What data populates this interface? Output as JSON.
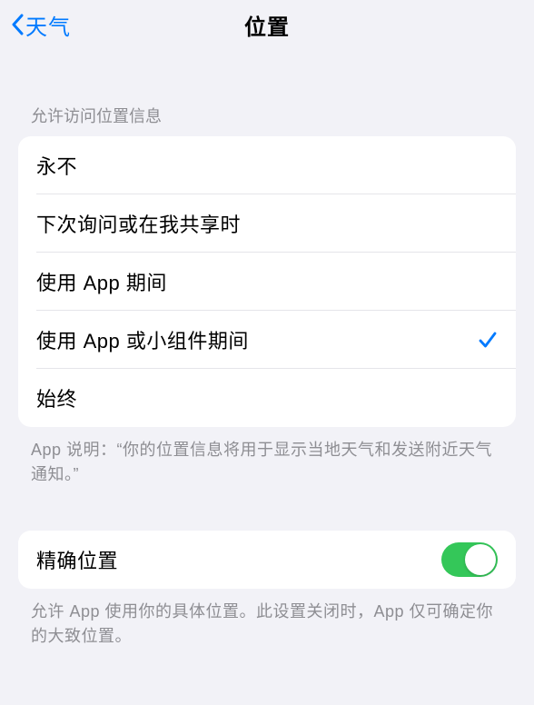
{
  "nav": {
    "back_label": "天气",
    "title": "位置"
  },
  "section1": {
    "header": "允许访问位置信息",
    "options": [
      {
        "label": "永不",
        "selected": false
      },
      {
        "label": "下次询问或在我共享时",
        "selected": false
      },
      {
        "label": "使用 App 期间",
        "selected": false
      },
      {
        "label": "使用 App 或小组件期间",
        "selected": true
      },
      {
        "label": "始终",
        "selected": false
      }
    ],
    "footer": "App 说明：“你的位置信息将用于显示当地天气和发送附近天气通知。”"
  },
  "section2": {
    "precise_label": "精确位置",
    "precise_on": true,
    "footer": "允许 App 使用你的具体位置。此设置关闭时，App 仅可确定你的大致位置。"
  }
}
